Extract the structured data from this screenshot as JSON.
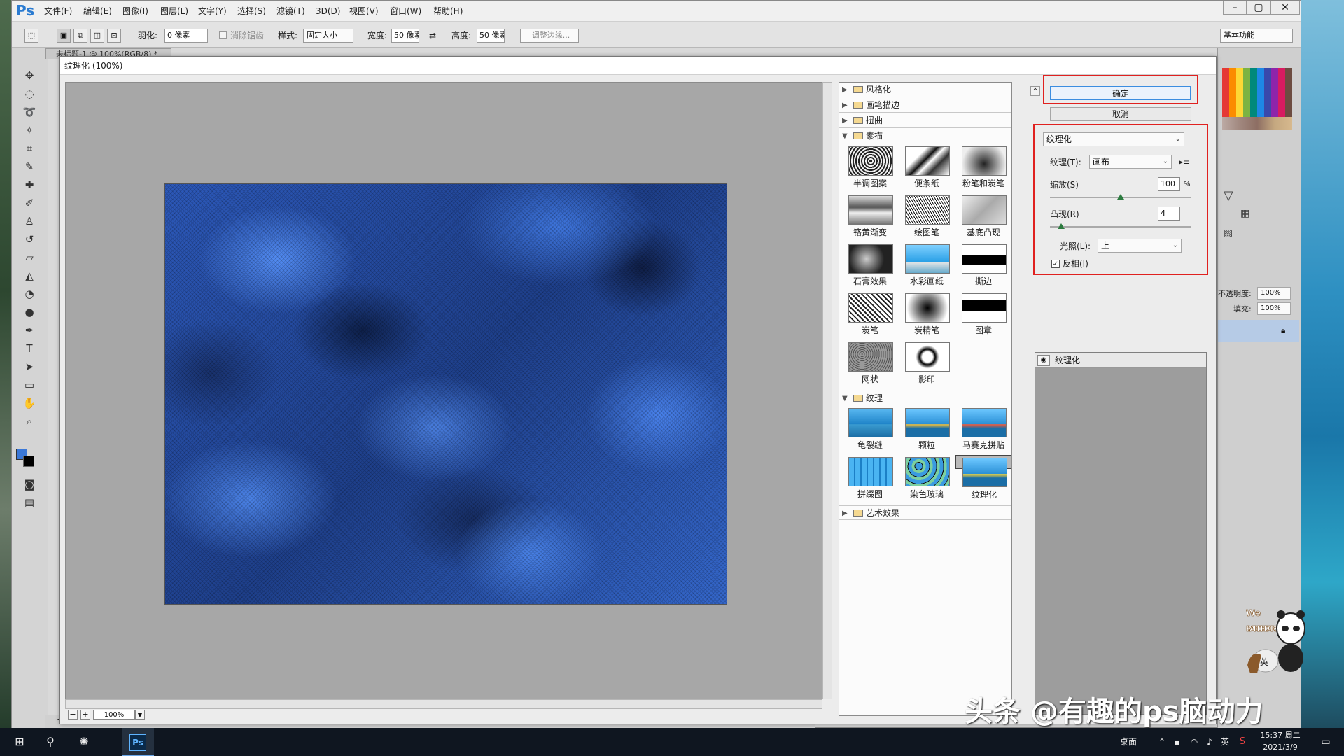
{
  "app": {
    "logo": "Ps",
    "menus": [
      "文件(F)",
      "编辑(E)",
      "图像(I)",
      "图层(L)",
      "文字(Y)",
      "选择(S)",
      "滤镜(T)",
      "3D(D)",
      "视图(V)",
      "窗口(W)",
      "帮助(H)"
    ],
    "window_controls": [
      "–",
      "▢",
      "✕"
    ],
    "workspace": "基本功能",
    "doc_tab": "未标题-1 @ 100%(RGB/8) *",
    "status_zoom": "100"
  },
  "options": {
    "feather_label": "羽化:",
    "feather_value": "0 像素",
    "antialias_label": "消除锯齿",
    "style_label": "样式:",
    "style_value": "固定大小",
    "width_label": "宽度:",
    "width_value": "50 像素",
    "height_label": "高度:",
    "height_value": "50 像素",
    "refine_edge": "调整边缘..."
  },
  "dialog": {
    "title": "纹理化 (100%)",
    "zoom_value": "100%",
    "ok_label": "确定",
    "cancel_label": "取消",
    "filter_select": "纹理化",
    "texture_label": "纹理(T):",
    "texture_value": "画布",
    "scale_label": "缩放(S)",
    "scale_value": "100",
    "scale_unit": "%",
    "scale_level": 0.5,
    "relief_label": "凸现(R)",
    "relief_value": "4",
    "relief_level": 0.08,
    "light_label": "光照(L):",
    "light_value": "上",
    "invert_label": "反相(I)",
    "invert_checked": true,
    "layer_name": "纹理化"
  },
  "gallery": {
    "folders": {
      "stylize": "风格化",
      "brush": "画笔描边",
      "distort": "扭曲",
      "sketch": "素描",
      "texture": "纹理",
      "artistic": "艺术效果"
    },
    "sketch_items": [
      "半调图案",
      "便条纸",
      "粉笔和炭笔",
      "铬黄渐变",
      "绘图笔",
      "基底凸现",
      "石膏效果",
      "水彩画纸",
      "撕边",
      "炭笔",
      "炭精笔",
      "图章",
      "网状",
      "影印"
    ],
    "texture_items": [
      "龟裂缝",
      "颗粒",
      "马赛克拼贴",
      "拼缀图",
      "染色玻璃",
      "纹理化"
    ],
    "selected": "纹理化"
  },
  "right_panel": {
    "opacity_label": "不透明度:",
    "opacity_value": "100%",
    "fill_label": "填充:",
    "fill_value": "100%"
  },
  "taskbar": {
    "desktop_label": "桌面",
    "ime_label": "英",
    "time": "15:37 周二",
    "date": "2021/3/9"
  },
  "watermark": "头条 @有趣的ps脑动力",
  "bear": {
    "brand_top": "We",
    "brand_bottom": "BARE BEARS",
    "ime_label": "英"
  },
  "colors": {
    "accent_blue": "#3b8de0",
    "highlight_red": "#e0211f",
    "canvas_blue": "#2c58b8"
  }
}
